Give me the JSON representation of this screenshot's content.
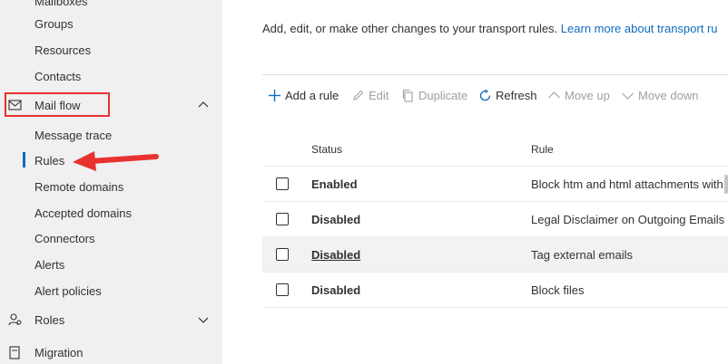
{
  "sidebar": {
    "items": [
      {
        "label": "Mailboxes"
      },
      {
        "label": "Groups"
      },
      {
        "label": "Resources"
      },
      {
        "label": "Contacts"
      },
      {
        "label": "Mail flow",
        "icon": "mail-icon",
        "expanded": true
      },
      {
        "label": "Message trace"
      },
      {
        "label": "Rules",
        "active": true
      },
      {
        "label": "Remote domains"
      },
      {
        "label": "Accepted domains"
      },
      {
        "label": "Connectors"
      },
      {
        "label": "Alerts"
      },
      {
        "label": "Alert policies"
      },
      {
        "label": "Roles",
        "icon": "roles-icon",
        "expanded": false
      },
      {
        "label": "Migration",
        "icon": "migration-icon"
      }
    ]
  },
  "main": {
    "description": "Add, edit, or make other changes to your transport rules. ",
    "description_link": "Learn more about transport ru",
    "toolbar": {
      "add": "Add a rule",
      "edit": "Edit",
      "duplicate": "Duplicate",
      "refresh": "Refresh",
      "move_up": "Move up",
      "move_down": "Move down"
    },
    "table": {
      "headers": {
        "status": "Status",
        "rule": "Rule"
      },
      "rows": [
        {
          "status": "Enabled",
          "rule": "Block htm and html attachments with"
        },
        {
          "status": "Disabled",
          "rule": "Legal Disclaimer on Outgoing Emails"
        },
        {
          "status": "Disabled",
          "rule": "Tag external emails"
        },
        {
          "status": "Disabled",
          "rule": "Block files"
        }
      ]
    }
  },
  "colors": {
    "accent": "#0f6cbd",
    "annotation": "#e8322f",
    "sidebar_bg": "#f0f0f0"
  }
}
